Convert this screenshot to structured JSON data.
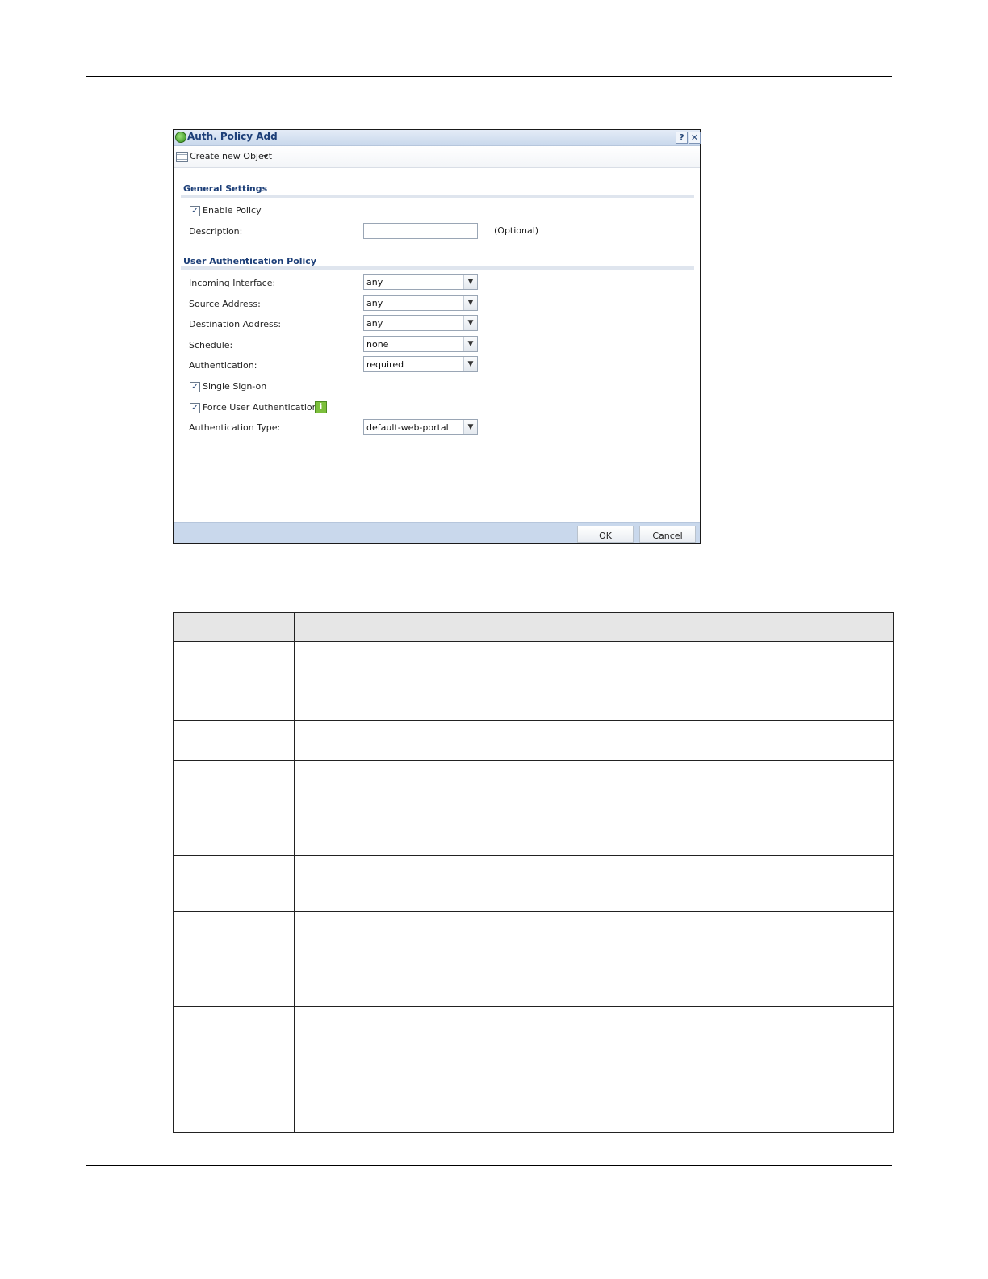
{
  "dialog": {
    "title": "Auth. Policy Add",
    "help_label": "?",
    "close_label": "✕",
    "toolbar": {
      "create_label": "Create new Object"
    },
    "general": {
      "title": "General Settings",
      "enable_policy_label": "Enable Policy",
      "enable_policy_checked": true,
      "description_label": "Description:",
      "description_value": "",
      "optional_label": "(Optional)"
    },
    "auth_policy": {
      "title": "User Authentication Policy",
      "incoming_label": "Incoming Interface:",
      "incoming_value": "any",
      "source_label": "Source Address:",
      "source_value": "any",
      "destination_label": "Destination Address:",
      "destination_value": "any",
      "schedule_label": "Schedule:",
      "schedule_value": "none",
      "authentication_label": "Authentication:",
      "authentication_value": "required",
      "sso_label": "Single Sign-on",
      "sso_checked": true,
      "force_label": "Force User Authentication",
      "force_checked": true,
      "auth_type_label": "Authentication Type:",
      "auth_type_value": "default-web-portal"
    },
    "ok_label": "OK",
    "cancel_label": "Cancel"
  },
  "colors": {
    "title_text": "#1d3f78",
    "titlebar_bg": "#c9d8ec",
    "info_icon": "#7cbf3b"
  }
}
